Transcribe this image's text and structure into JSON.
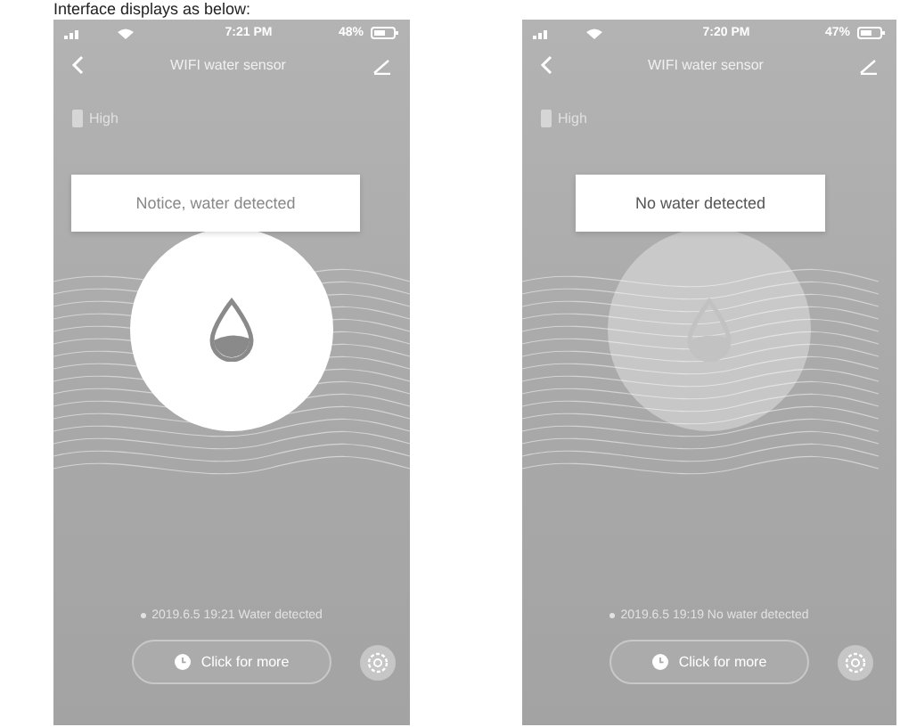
{
  "caption": "Interface displays as below:",
  "screens": [
    {
      "status_bar": {
        "time": "7:21 PM",
        "battery": "48%"
      },
      "title": "WIFI water sensor",
      "battery_label": "High",
      "notice": "Notice, water detected",
      "detected": true,
      "log": "2019.6.5 19:21 Water detected",
      "more_button": "Click for more"
    },
    {
      "status_bar": {
        "time": "7:20 PM",
        "battery": "47%"
      },
      "title": "WIFI water sensor",
      "battery_label": "High",
      "notice": "No water detected",
      "detected": false,
      "log": "2019.6.5 19:19 No water detected",
      "more_button": "Click for more"
    }
  ]
}
